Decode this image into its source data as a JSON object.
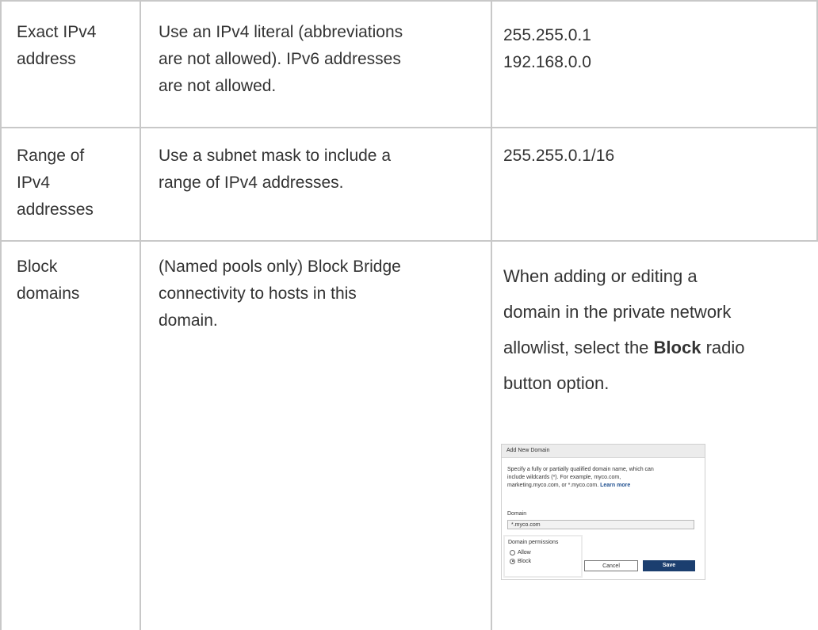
{
  "rows": [
    {
      "type_lines": [
        "Exact IPv4",
        "address"
      ],
      "description_lines": [
        "Use an IPv4 literal (abbreviations",
        "are not allowed). IPv6 addresses",
        "are not allowed."
      ],
      "example_lines": [
        "255.255.0.1",
        "192.168.0.0"
      ]
    },
    {
      "type_lines": [
        "Range of",
        "IPv4",
        "addresses"
      ],
      "description_lines": [
        "Use a subnet mask to include a",
        "range of IPv4 addresses."
      ],
      "example_lines": [
        "255.255.0.1/16"
      ]
    },
    {
      "type_lines": [
        "Block",
        "domains"
      ],
      "description_lines": [
        "(Named pools only) Block Bridge",
        "connectivity to hosts in this",
        "domain."
      ],
      "example": {
        "line1": "When adding or editing a",
        "line2": "domain in the private network",
        "line3_pre": "allowlist, select the ",
        "line3_bold": "Block",
        "line3_post": " radio",
        "line4": "button option."
      }
    }
  ],
  "dialog": {
    "title": "Add New Domain",
    "desc_line1": "Specify a fully or partially qualified domain name, which can",
    "desc_line2": "include wildcards (*). For example, myco.com,",
    "desc_line3_pre": "marketing.myco.com, or *.myco.com.",
    "learn_more": "Learn more",
    "domain_label": "Domain",
    "domain_value": "*.myco.com",
    "permissions_label": "Domain permissions",
    "option_allow": "Allow",
    "option_block": "Block",
    "selected_option": "Block",
    "cancel_label": "Cancel",
    "save_label": "Save"
  }
}
